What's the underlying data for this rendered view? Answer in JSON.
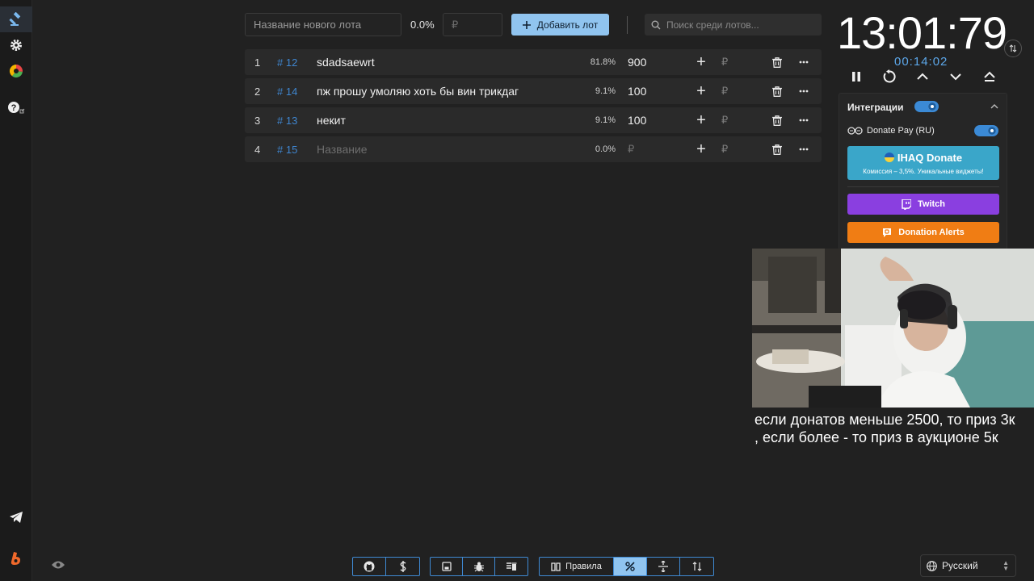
{
  "sidebar": {
    "items": [
      {
        "icon": "gavel-icon",
        "active": true
      },
      {
        "icon": "gear-icon"
      },
      {
        "icon": "pie-chart-icon"
      },
      {
        "icon": "help-icon"
      },
      {
        "icon": "telegram-icon"
      },
      {
        "icon": "boosty-icon"
      }
    ]
  },
  "topbar": {
    "new_lot_placeholder": "Название нового лота",
    "percent": "0.0%",
    "amount_placeholder": "₽",
    "add_button": "Добавить лот",
    "search_placeholder": "Поиск среди лотов..."
  },
  "lots": [
    {
      "index": "1",
      "id": "# 12",
      "name": "sdadsaewrt",
      "percent": "81.8%",
      "amount": "900",
      "currency": "₽"
    },
    {
      "index": "2",
      "id": "# 14",
      "name": "пж прошу умоляю хоть бы вин трикдаг",
      "percent": "9.1%",
      "amount": "100",
      "currency": "₽"
    },
    {
      "index": "3",
      "id": "# 13",
      "name": "некит",
      "percent": "9.1%",
      "amount": "100",
      "currency": "₽"
    },
    {
      "index": "4",
      "id": "# 15",
      "name": "Название",
      "percent": "0.0%",
      "amount": "₽",
      "currency": "₽",
      "empty": true
    }
  ],
  "timer": {
    "main": "13:01:79",
    "sub": "00:14:02"
  },
  "integrations": {
    "title": "Интеграции",
    "enabled": true,
    "donatepay_label": "Donate Pay (RU)",
    "donatepay_enabled": true,
    "ihaq_title": "IHAQ Donate",
    "ihaq_subtitle": "Комиссия – 3,5%. Уникальные виджеты!",
    "twitch": "Twitch",
    "donation_alerts": "Donation Alerts",
    "colors": {
      "ihaq": "#3aa6c9",
      "twitch": "#8a3fe0",
      "donation_alerts": "#f07d14"
    }
  },
  "caption": {
    "line1": "если донатов меньше 2500, то приз 3к",
    "line2": ", если более - то приз в аукционе 5к"
  },
  "bottom": {
    "rules": "Правила",
    "language": "Русский"
  }
}
